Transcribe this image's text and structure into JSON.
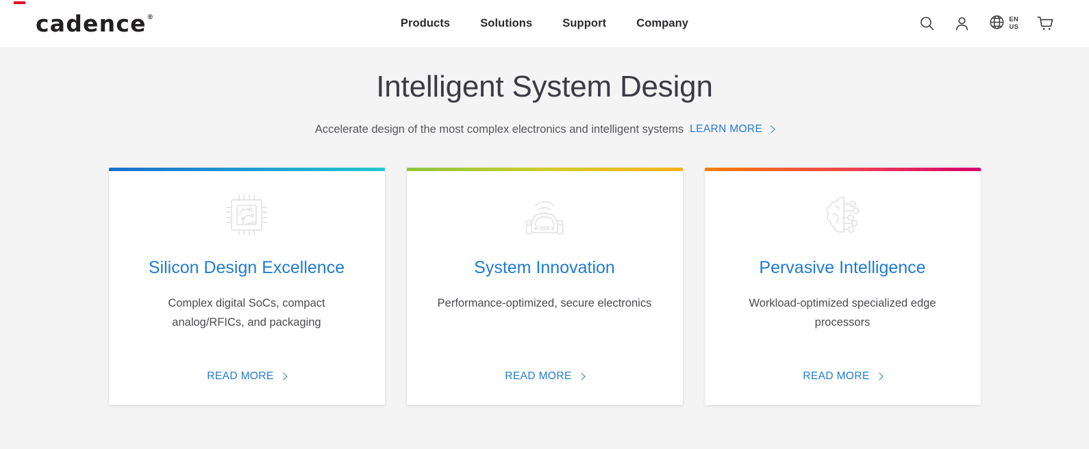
{
  "header": {
    "logo": {
      "text": "cadence",
      "registered": "®",
      "accent_color": "#e4002b"
    },
    "nav": [
      {
        "label": "Products"
      },
      {
        "label": "Solutions"
      },
      {
        "label": "Support"
      },
      {
        "label": "Company"
      }
    ],
    "actions": {
      "search": "search-icon",
      "account": "person-icon",
      "locale_icon": "globe-icon",
      "locale_label": "EN\nUS",
      "cart": "cart-icon"
    }
  },
  "hero": {
    "title": "Intelligent System Design",
    "subtitle": "Accelerate design of the most complex electronics and intelligent systems",
    "learn_more": "LEARN MORE"
  },
  "cards": [
    {
      "title": "Silicon Design Excellence",
      "description": "Complex digital SoCs, compact analog/RFICs, and packaging",
      "cta": "READ MORE",
      "icon": "microchip-icon",
      "bar_from": "#1070cf",
      "bar_to": "#22c8cd"
    },
    {
      "title": "System Innovation",
      "description": "Performance-optimized, secure electronics",
      "cta": "READ MORE",
      "icon": "connected-car-icon",
      "bar_from": "#8cc63f",
      "bar_to": "#fbb116"
    },
    {
      "title": "Pervasive Intelligence",
      "description": "Workload-optimized specialized edge processors",
      "cta": "READ MORE",
      "icon": "ai-brain-icon",
      "bar_from": "#f77f00",
      "bar_to": "#d6006e"
    }
  ],
  "theme": {
    "page_background": "#f4f4f4",
    "link_color": "#1f7bd4",
    "text_color": "#3c3c41"
  }
}
